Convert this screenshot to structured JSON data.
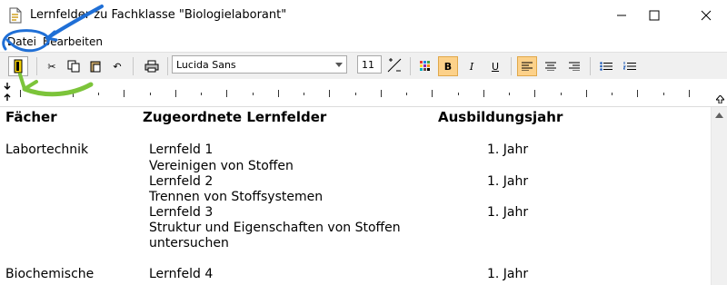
{
  "window": {
    "title": "Lernfelder zu Fachklasse \"Biologielaborant\"",
    "controls": {
      "minimize": "—",
      "maximize": "☐",
      "close": "✕"
    }
  },
  "menu": {
    "items": [
      "Datei",
      "Bearbeiten"
    ]
  },
  "toolbar": {
    "font": "Lucida Sans",
    "size": "11",
    "bold_label": "B",
    "italic_label": "I",
    "underline_label": "U"
  },
  "annotation_colors": {
    "blue": "#1f6fd6",
    "green": "#7cc43a"
  },
  "table": {
    "headers": [
      "Fächer",
      "Zugeordnete Lernfelder",
      "Ausbildungsjahr"
    ],
    "rows": [
      {
        "fach": "Labortechnik",
        "lines": [
          "Lernfeld 1",
          "Vereinigen von Stoffen",
          "Lernfeld 2",
          "Trennen von Stoffsystemen",
          "Lernfeld 3",
          "Struktur und Eigenschaften von Stoffen",
          "untersuchen"
        ],
        "jahre": [
          "1. Jahr",
          "1. Jahr",
          "1. Jahr"
        ]
      },
      {
        "fach": "Biochemische",
        "lines": [
          "Lernfeld 4"
        ],
        "jahre": [
          "1. Jahr"
        ]
      }
    ]
  }
}
